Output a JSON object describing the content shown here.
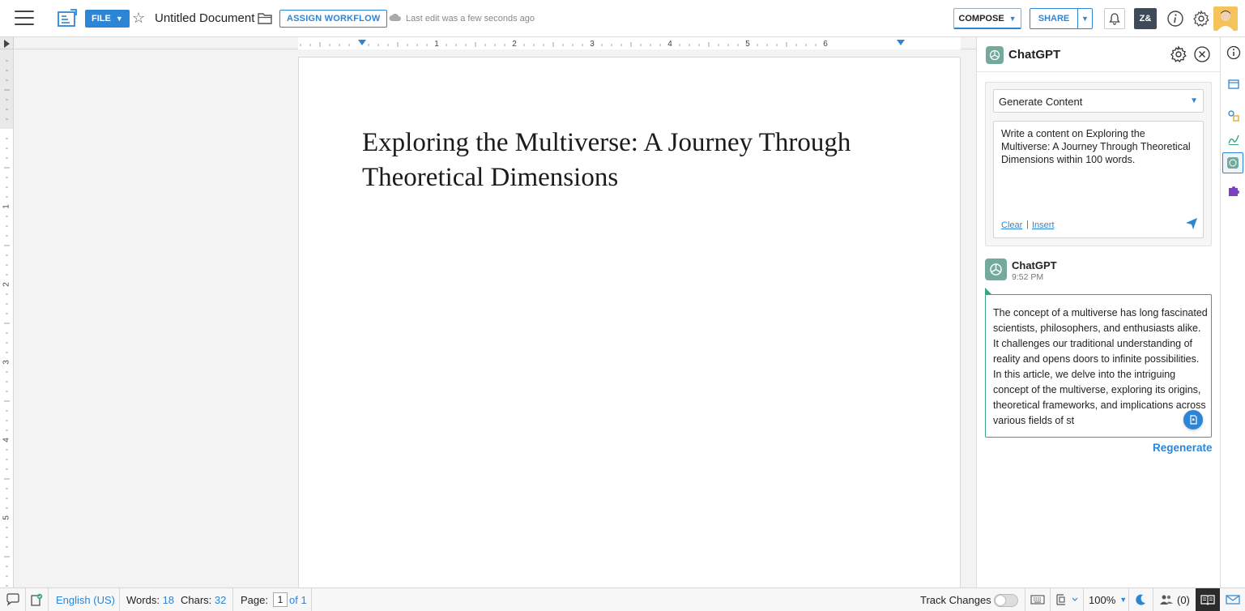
{
  "header": {
    "file_label": "FILE",
    "document_title": "Untitled Document",
    "assign_workflow_label": "ASSIGN WORKFLOW",
    "last_edit": "Last edit was a few seconds ago",
    "compose_label": "COMPOSE",
    "share_label": "SHARE",
    "zia_label": "Z&"
  },
  "ruler": {
    "h_ticks": [
      "1",
      "2",
      "3",
      "4",
      "5",
      "6"
    ],
    "v_ticks": [
      "1",
      "2",
      "3",
      "4",
      "5"
    ]
  },
  "document": {
    "heading": "Exploring the Multiverse: A Journey Through Theoretical Dimensions"
  },
  "chatgpt_panel": {
    "title": "ChatGPT",
    "mode_select": "Generate Content",
    "prompt": "Write a content on Exploring the Multiverse: A Journey Through Theoretical Dimensions within 100 words.",
    "clear_label": "Clear",
    "separator": "|",
    "insert_label": "Insert",
    "response": {
      "author": "ChatGPT",
      "time": "9:52 PM",
      "text": "The concept of a multiverse has long fascinated scientists, philosophers, and enthusiasts alike. It challenges our traditional understanding of reality and opens doors to infinite possibilities. In this article, we delve into the intriguing concept of the multiverse, exploring its origins, theoretical frameworks, and implications across various fields of st"
    },
    "regenerate_label": "Regenerate"
  },
  "statusbar": {
    "language": "English (US)",
    "words_label": "Words:",
    "words_value": "18",
    "chars_label": "Chars:",
    "chars_value": "32",
    "page_label": "Page:",
    "page_current": "1",
    "page_total": "of 1",
    "track_changes": "Track Changes",
    "zoom": "100%",
    "collaborators": "(0)"
  },
  "colors": {
    "accent": "#2d85d5",
    "chatgpt_green": "#74aa9c",
    "response_border": "#3aa385",
    "zia_bg": "#3f4a59"
  }
}
